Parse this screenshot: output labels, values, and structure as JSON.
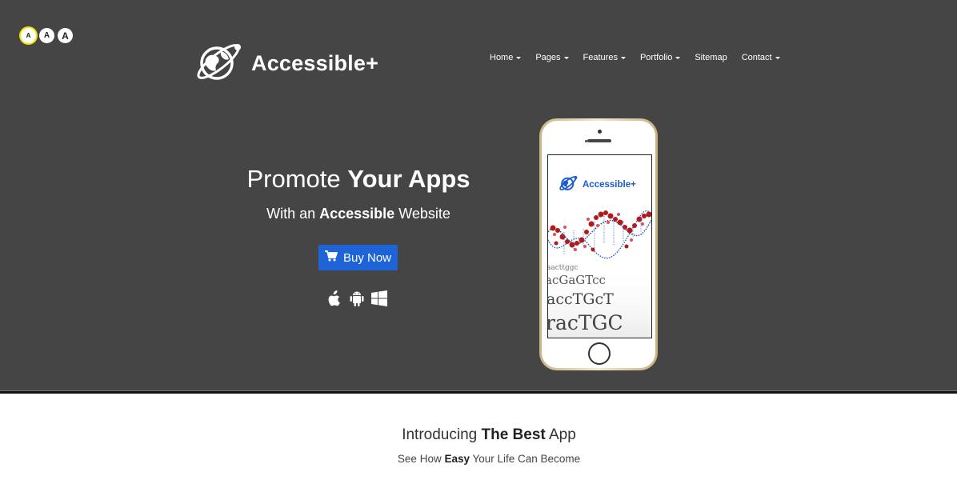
{
  "font_sizes": {
    "small": "A",
    "medium": "A",
    "large": "A"
  },
  "brand": {
    "name": "Accessible+"
  },
  "nav": {
    "items": [
      {
        "label": "Home",
        "dropdown": true
      },
      {
        "label": "Pages",
        "dropdown": true
      },
      {
        "label": "Features",
        "dropdown": true
      },
      {
        "label": "Portfolio",
        "dropdown": true
      },
      {
        "label": "Sitemap",
        "dropdown": false
      },
      {
        "label": "Contact",
        "dropdown": true
      }
    ]
  },
  "hero": {
    "title_normal": "Promote ",
    "title_bold": "Your Apps",
    "subtitle_pre": "With an ",
    "subtitle_bold": "Accessible",
    "subtitle_post": " Website",
    "buy_label": "Buy Now",
    "platforms": [
      "apple-icon",
      "android-icon",
      "windows-icon"
    ]
  },
  "phone": {
    "screen_brand": "Accessible+",
    "dna_text": [
      "aacttggc",
      "acGaGTcc",
      "accTGcT",
      "racTGC"
    ]
  },
  "intro": {
    "title_pre": "Introducing ",
    "title_bold": "The Best",
    "title_post": " App",
    "sub_1": "See How ",
    "sub_bold": "Easy",
    "sub_2": " Your Life Can Become"
  },
  "colors": {
    "hero_bg": "#454545",
    "accent": "#1f63d8",
    "highlight": "#f5e000"
  }
}
